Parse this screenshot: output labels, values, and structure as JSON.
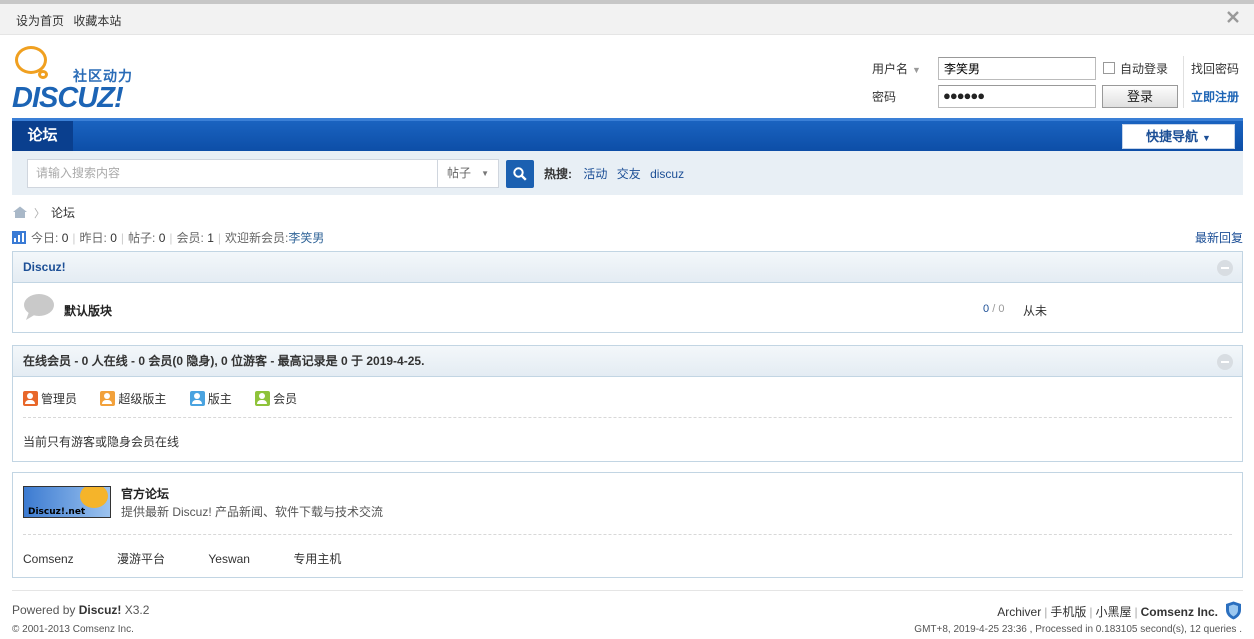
{
  "topbar": {
    "set_home": "设为首页",
    "favorite": "收藏本站",
    "close_icon": "close-icon"
  },
  "logo": {
    "subtitle": "社区动力",
    "wordmark": "DISCUZ!"
  },
  "login": {
    "username_label": "用户名",
    "username_value": "李笑男",
    "password_label": "密码",
    "password_mask": "●●●●●●",
    "auto_login": "自动登录",
    "login_button": "登录",
    "find_password": "找回密码",
    "register": "立即注册"
  },
  "nav": {
    "forum_tab": "论坛",
    "quick_nav": "快捷导航"
  },
  "search": {
    "placeholder": "请输入搜索内容",
    "scope": "帖子",
    "hot_label": "热搜:",
    "hot_words": [
      "活动",
      "交友",
      "discuz"
    ]
  },
  "breadcrumb": {
    "current": "论坛"
  },
  "stats": {
    "today_label": "今日:",
    "today": "0",
    "yesterday_label": "昨日:",
    "yesterday": "0",
    "posts_label": "帖子:",
    "posts": "0",
    "members_label": "会员:",
    "members": "1",
    "welcome_label": "欢迎新会员:",
    "newest_member": "李笑男",
    "latest_replies": "最新回复"
  },
  "category": {
    "title": "Discuz!",
    "forum_name": "默认版块",
    "threads": "0",
    "sep": "/",
    "posts": "0",
    "last_post": "从未"
  },
  "online": {
    "title": "在线会员 - 0 人在线 - 0 会员(0 隐身), 0 位游客 - 最高记录是 0 于 2019-4-25.",
    "legend": [
      {
        "label": "管理员",
        "color": "#e8672a"
      },
      {
        "label": "超级版主",
        "color": "#f2a13b"
      },
      {
        "label": "版主",
        "color": "#4aa3e0"
      },
      {
        "label": "会员",
        "color": "#8fc33a"
      }
    ],
    "message": "当前只有游客或隐身会员在线"
  },
  "friendlinks": {
    "banner_text": "Discuz!.net",
    "title": "官方论坛",
    "description": "提供最新 Discuz! 产品新闻、软件下载与技术交流",
    "links": [
      "Comsenz",
      "漫游平台",
      "Yeswan",
      "专用主机"
    ]
  },
  "footer": {
    "powered_by": "Powered by",
    "product": "Discuz!",
    "version": "X3.2",
    "copyright": "© 2001-2013 Comsenz Inc.",
    "links": [
      "Archiver",
      "手机版",
      "小黑屋"
    ],
    "company": "Comsenz Inc.",
    "processed": "GMT+8, 2019-4-25 23:36 , Processed in 0.183105 second(s), 12 queries ."
  }
}
